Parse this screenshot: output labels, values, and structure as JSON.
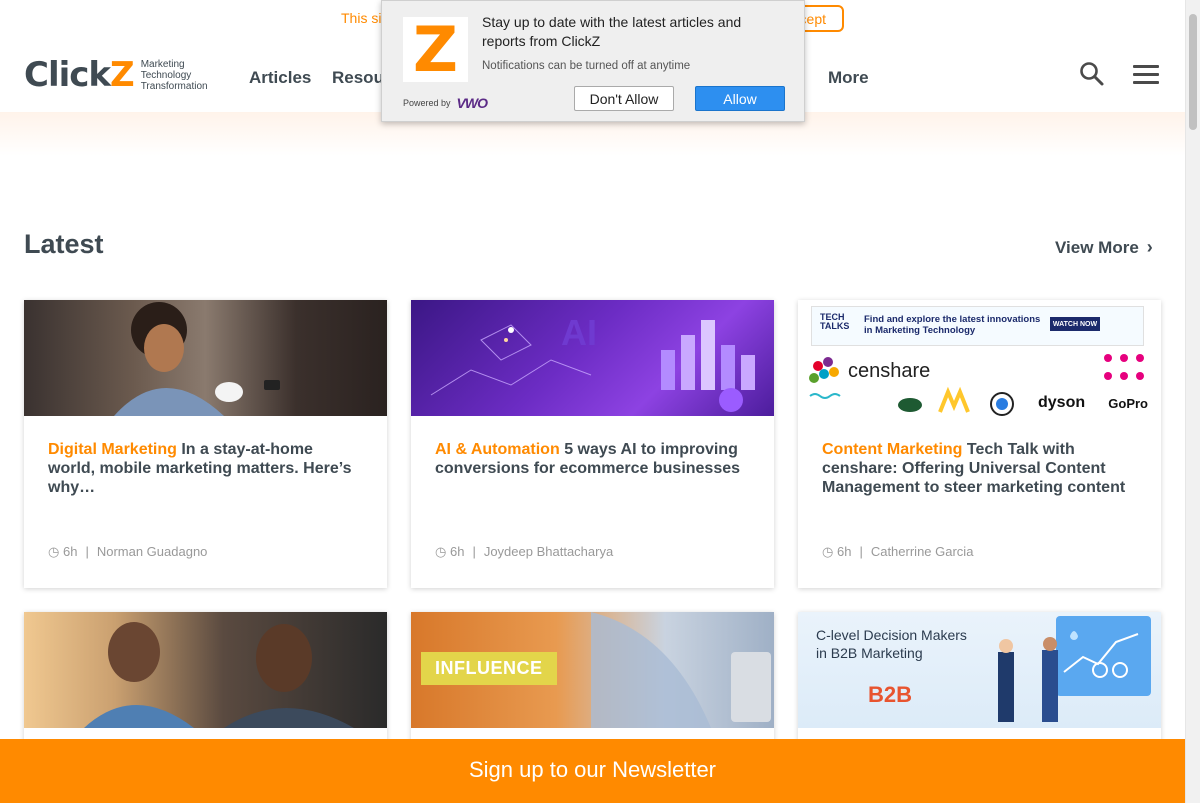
{
  "cookie": {
    "text": "This si",
    "accept": "cept"
  },
  "header": {
    "logo_word_1": "Click",
    "logo_word_2": "Z",
    "logo_tag_1": "Marketing",
    "logo_tag_2": "Technology",
    "logo_tag_3": "Transformation",
    "nav": [
      "Articles",
      "Resou",
      "More"
    ]
  },
  "notification": {
    "logo_letter": "Z",
    "title": "Stay up to date with the latest articles and reports from ClickZ",
    "subtitle": "Notifications can be turned off at anytime",
    "powered_by": "Powered by",
    "powered_brand": "VWO",
    "dont_allow": "Don't Allow",
    "allow": "Allow"
  },
  "latest": {
    "title": "Latest",
    "view_more": "View More"
  },
  "cards": [
    {
      "category": "Digital Marketing",
      "title": "In a stay-at-home world, mobile marketing matters. Here’s why…",
      "age": "6h",
      "author": "Norman Guadagno"
    },
    {
      "category": "AI & Automation",
      "title": "5 ways AI to improving conversions for ecommerce businesses",
      "age": "6h",
      "author": "Joydeep Bhattacharya"
    },
    {
      "category": "Content Marketing",
      "title": "Tech Talk with censhare: Offering Universal Content Management to steer marketing content",
      "age": "6h",
      "author": "Catherrine Garcia"
    }
  ],
  "card_images": {
    "influence": "INFLUENCE",
    "cdm_line1": "C-level Decision Makers",
    "cdm_line2": "in B2B Marketing",
    "b2b": "B2B",
    "tt_logo_1": "TECH",
    "tt_logo_2": "TALKS",
    "tt_text_1": "Find and explore the latest innovations",
    "tt_text_2": "in Marketing Technology",
    "tt_watch": "WATCH NOW",
    "censhare": "censhare",
    "brands": [
      "dyson",
      "GoPro"
    ]
  },
  "newsletter": {
    "label": "Sign up to our Newsletter"
  },
  "colors": {
    "brand_orange": "#ff8a00",
    "text_dark": "#3f4a52",
    "allow_blue": "#2d8ff0"
  }
}
